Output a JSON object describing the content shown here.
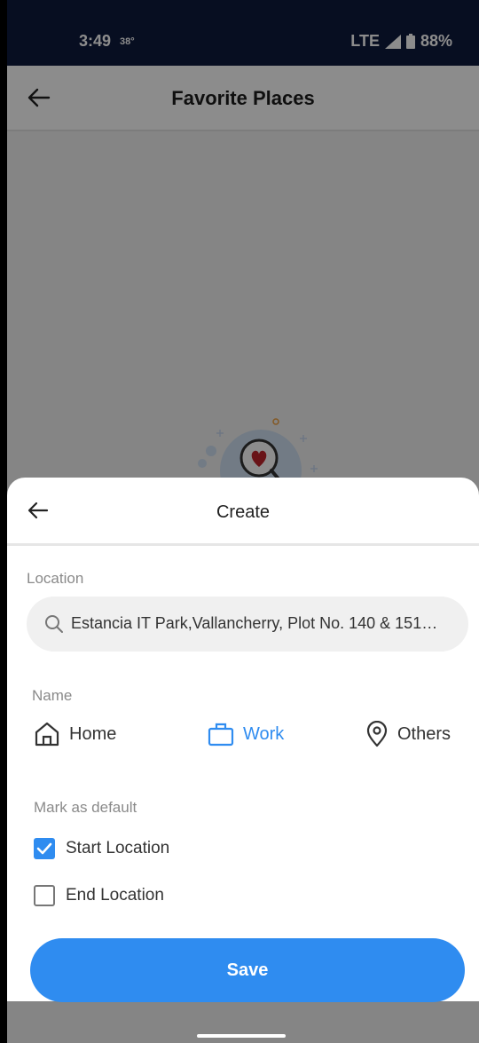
{
  "status_bar": {
    "time": "3:49",
    "temperature": "38°",
    "network": "LTE",
    "battery": "88%"
  },
  "app_bar": {
    "title": "Favorite Places"
  },
  "sheet": {
    "title": "Create",
    "location_label": "Location",
    "location_value": "Estancia IT Park,Vallancherry, Plot No. 140 & 151…",
    "name_label": "Name",
    "name_options": [
      {
        "label": "Home",
        "icon": "home-icon",
        "selected": false
      },
      {
        "label": "Work",
        "icon": "briefcase-icon",
        "selected": true
      },
      {
        "label": "Others",
        "icon": "location-pin-icon",
        "selected": false
      }
    ],
    "default_label": "Mark as default",
    "checkboxes": [
      {
        "label": "Start Location",
        "checked": true
      },
      {
        "label": "End Location",
        "checked": false
      }
    ],
    "save_label": "Save"
  },
  "colors": {
    "accent": "#2f8cf0",
    "status_bar": "#0e1a3d"
  }
}
